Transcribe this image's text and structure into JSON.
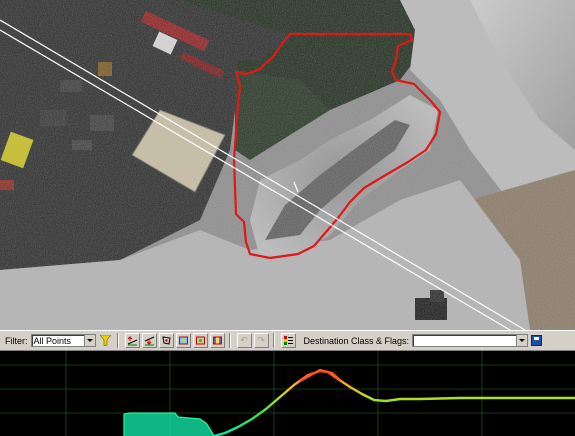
{
  "toolbar": {
    "filter_label": "Filter:",
    "filter_value": "All Points",
    "destination_label": "Destination Class & Flags:",
    "destination_value": "",
    "tools": [
      {
        "icon": "funnel-icon",
        "label": "filter"
      },
      {
        "icon": "classify-above-line-icon",
        "label": "above line"
      },
      {
        "icon": "classify-below-line-icon",
        "label": "below line"
      },
      {
        "icon": "classify-fence-icon",
        "label": "inside fence"
      },
      {
        "icon": "classify-rectangle-icon",
        "label": "rectangle"
      },
      {
        "icon": "classify-brush-icon",
        "label": "brush"
      },
      {
        "icon": "classify-range-icon",
        "label": "range"
      },
      {
        "icon": "undo-icon",
        "label": "undo"
      },
      {
        "icon": "redo-icon",
        "label": "redo"
      },
      {
        "icon": "class-legend-icon",
        "label": "classes"
      },
      {
        "icon": "save-icon",
        "label": "save"
      }
    ]
  },
  "colors": {
    "fence": "#e01818",
    "profile_line": "#ffffff",
    "toolbar_bg": "#d4d0c8",
    "profile_low": "#00e6a0",
    "profile_high": "#ff6a20"
  }
}
